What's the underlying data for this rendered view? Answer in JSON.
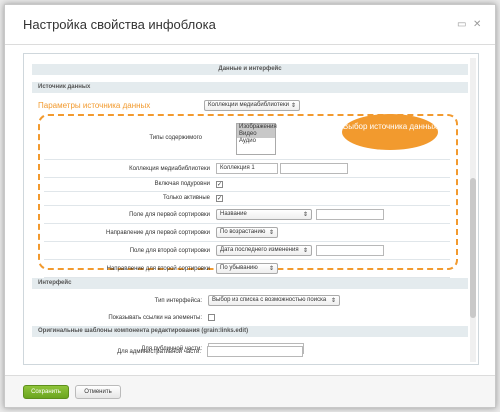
{
  "window": {
    "title": "Настройка свойства инфоблока"
  },
  "sections": {
    "data_interface": "Данные и интерфейс",
    "source": "Источник данных",
    "interface": "Интерфейс",
    "templates": "Оригинальные шаблоны компонента редактирования (grain:links.edit)"
  },
  "source": {
    "params_label": "Параметры источника данных",
    "source_select": "Коллекции медиабиблиотеки",
    "bubble": "Выбор источника данных"
  },
  "fields": {
    "content_types_label": "Типы содержимого",
    "content_types_options": [
      "Изображения",
      "Видео",
      "Аудио"
    ],
    "collection_label": "Коллекция медиабиблиотеки",
    "collection_value": "Коллекция 1",
    "include_sub_label": "Включая подуровни",
    "only_active_label": "Только активные",
    "sort1_field_label": "Поле для первой сортировки",
    "sort1_field_value": "Название",
    "sort1_dir_label": "Направление для первой сортировки",
    "sort1_dir_value": "По возрастанию",
    "sort2_field_label": "Поле для второй сортировки",
    "sort2_field_value": "Дата последнего изменения",
    "sort2_dir_label": "Направление для второй сортировки",
    "sort2_dir_value": "По убыванию"
  },
  "interface": {
    "type_label": "Тип интерфейса:",
    "type_value": "Выбор из списка с возможностью поиска",
    "show_links_label": "Показывать ссылки на элементы:"
  },
  "templates": {
    "public_label": "Для публичной части:",
    "admin_label": "Для административной части:"
  },
  "footer": {
    "save": "Сохранить",
    "cancel": "Отменить"
  }
}
